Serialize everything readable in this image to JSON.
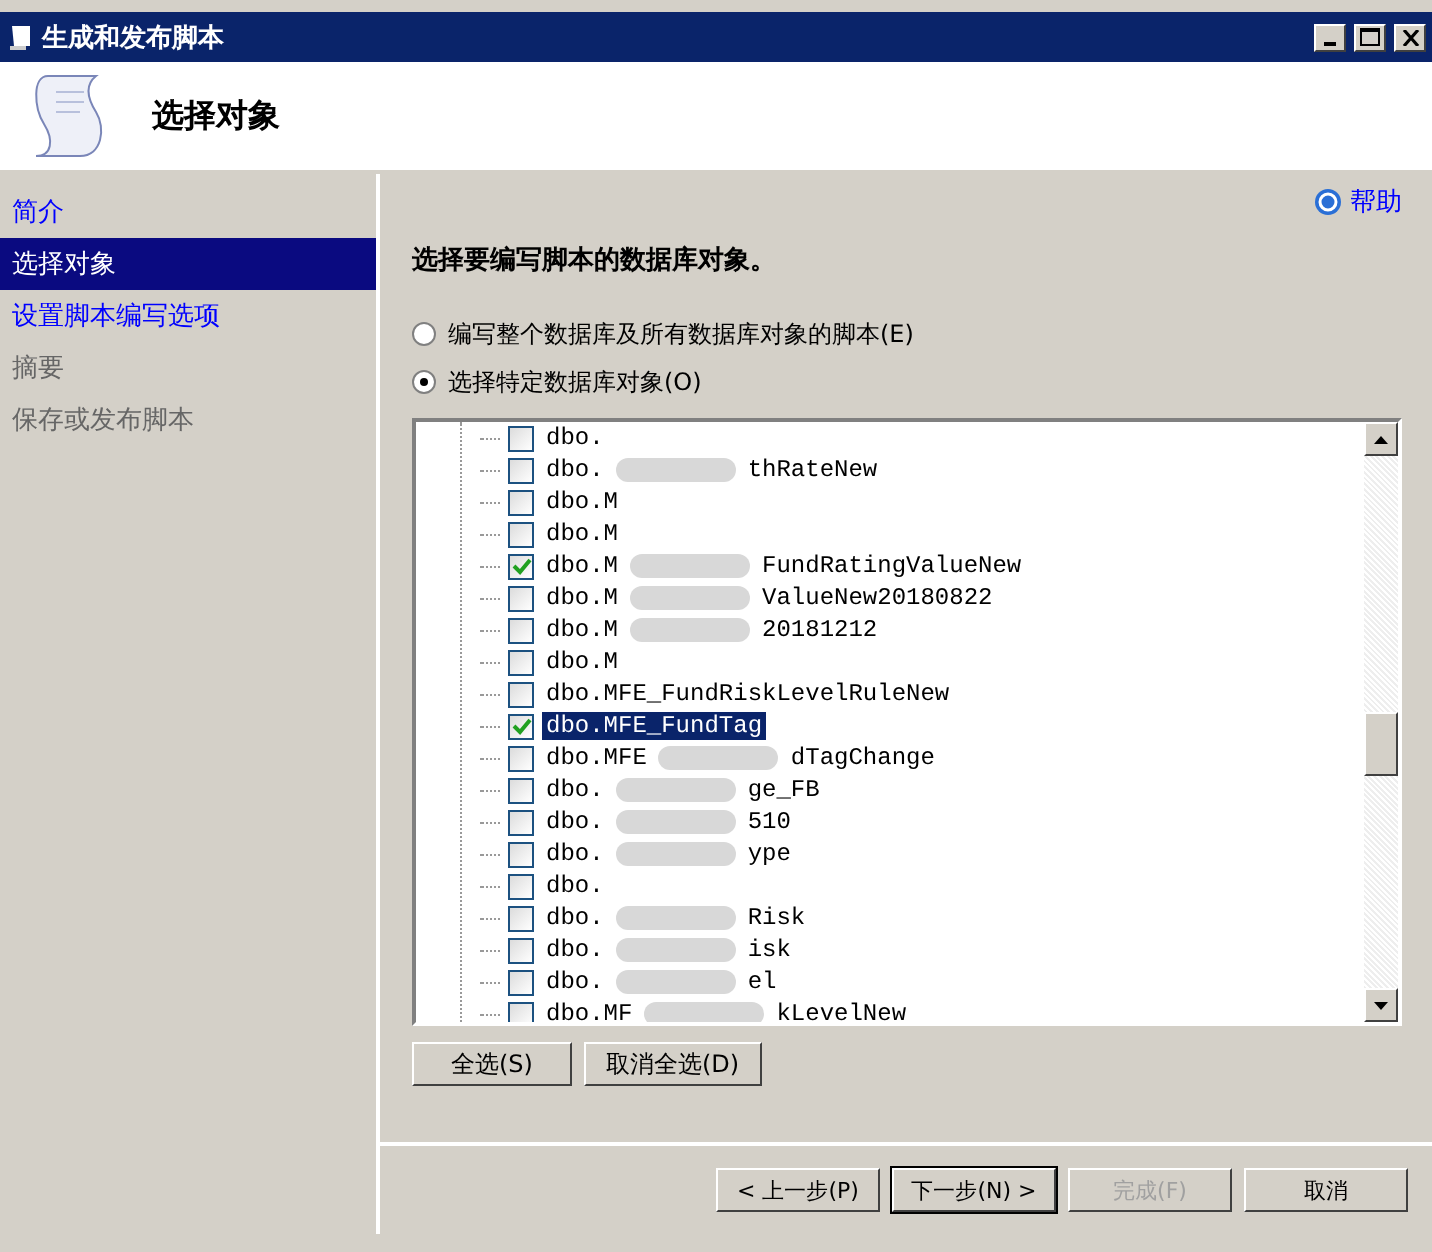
{
  "window": {
    "title": "生成和发布脚本"
  },
  "header": {
    "title": "选择对象"
  },
  "sidebar": {
    "items": [
      {
        "label": "简介",
        "selected": false,
        "enabled": true
      },
      {
        "label": "选择对象",
        "selected": true,
        "enabled": true
      },
      {
        "label": "设置脚本编写选项",
        "selected": false,
        "enabled": true
      },
      {
        "label": "摘要",
        "selected": false,
        "enabled": false
      },
      {
        "label": "保存或发布脚本",
        "selected": false,
        "enabled": false
      }
    ]
  },
  "help": "帮助",
  "instruction": "选择要编写脚本的数据库对象。",
  "options": [
    {
      "label": "编写整个数据库及所有数据库对象的脚本(E)",
      "selected": false
    },
    {
      "label": "选择特定数据库对象(O)",
      "selected": true
    }
  ],
  "objects": [
    {
      "prefix": "dbo.",
      "checked": false,
      "selected": false
    },
    {
      "prefix": "dbo.",
      "suffix": "thRateNew",
      "checked": false,
      "selected": false
    },
    {
      "prefix": "dbo.M",
      "checked": false,
      "selected": false
    },
    {
      "prefix": "dbo.M",
      "checked": false,
      "selected": false
    },
    {
      "prefix": "dbo.M",
      "suffix": "FundRatingValueNew",
      "checked": true,
      "selected": false
    },
    {
      "prefix": "dbo.M",
      "suffix": "ValueNew20180822",
      "checked": false,
      "selected": false
    },
    {
      "prefix": "dbo.M",
      "suffix": "20181212",
      "checked": false,
      "selected": false
    },
    {
      "prefix": "dbo.M",
      "checked": false,
      "selected": false
    },
    {
      "prefix": "dbo.MFE_FundRiskLevelRuleNew",
      "checked": false,
      "selected": false
    },
    {
      "prefix": "dbo.MFE_FundTag",
      "checked": true,
      "selected": true
    },
    {
      "prefix": "dbo.MFE",
      "suffix": "dTagChange",
      "checked": false,
      "selected": false
    },
    {
      "prefix": "dbo.",
      "suffix": "ge_FB",
      "checked": false,
      "selected": false
    },
    {
      "prefix": "dbo.",
      "suffix": "510",
      "checked": false,
      "selected": false
    },
    {
      "prefix": "dbo.",
      "suffix": "ype",
      "checked": false,
      "selected": false
    },
    {
      "prefix": "dbo.",
      "checked": false,
      "selected": false
    },
    {
      "prefix": "dbo.",
      "suffix": "Risk",
      "checked": false,
      "selected": false
    },
    {
      "prefix": "dbo.",
      "suffix": "isk",
      "checked": false,
      "selected": false
    },
    {
      "prefix": "dbo.",
      "suffix": "el",
      "checked": false,
      "selected": false
    },
    {
      "prefix": "dbo.MF",
      "suffix": "kLevelNew",
      "checked": false,
      "selected": false
    }
  ],
  "list_buttons": [
    "全选(S)",
    "取消全选(D)"
  ],
  "nav_buttons": [
    {
      "label": "< 上一步(P)",
      "disabled": false,
      "default": false
    },
    {
      "label": "下一步(N) >",
      "disabled": false,
      "default": true
    },
    {
      "label": "完成(F)",
      "disabled": true,
      "default": false
    },
    {
      "label": "取消",
      "disabled": false,
      "default": false
    }
  ]
}
